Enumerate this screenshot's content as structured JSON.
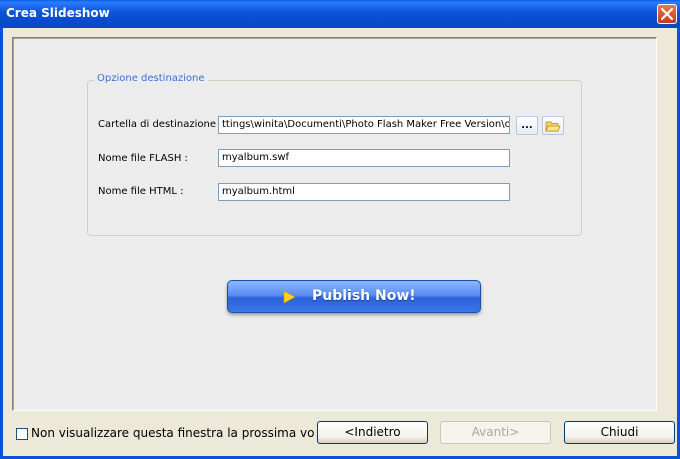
{
  "window": {
    "title": "Crea Slideshow"
  },
  "group": {
    "legend": "Opzione destinazione"
  },
  "fields": {
    "folder_label": "Cartella di destinazione :",
    "folder_value": "ttings\\winita\\Documenti\\Photo Flash Maker Free Version\\output\\",
    "flash_label": "Nome file FLASH :",
    "flash_value": "myalbum.swf",
    "html_label": "Nome file HTML :",
    "html_value": "myalbum.html",
    "browse_label": "..."
  },
  "publish": {
    "label": "Publish Now!"
  },
  "footer": {
    "checkbox_label": "Non visualizzare questa finestra la prossima vo",
    "checkbox_checked": false,
    "back_label": "<Indietro",
    "next_label": "Avanti>",
    "close_label": "Chiudi"
  },
  "icons": {
    "close": "close-icon",
    "folder": "folder-open-icon",
    "play": "play-icon"
  },
  "colors": {
    "titlebar": "#0a53d6",
    "legend": "#3a6fd8",
    "publish": "#3b76e8",
    "close": "#c7391a"
  }
}
